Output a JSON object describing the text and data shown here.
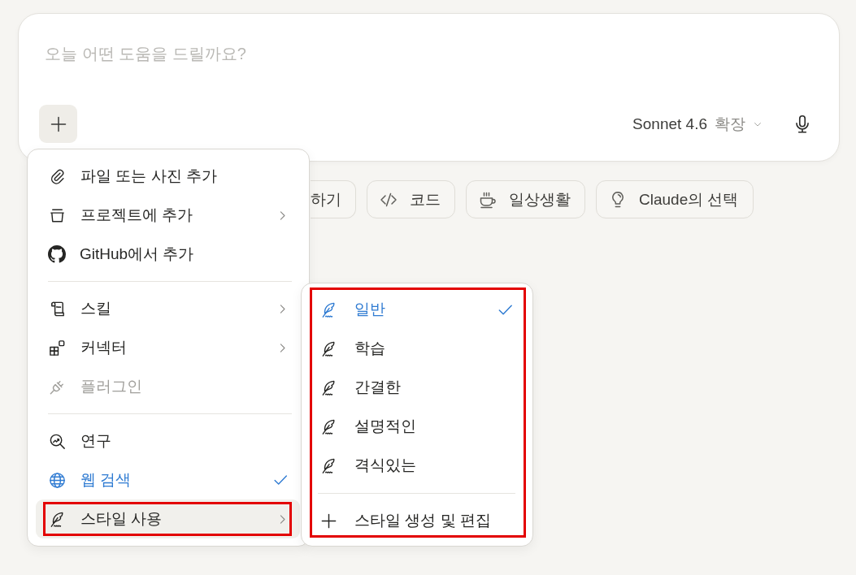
{
  "composer": {
    "placeholder": "오늘 어떤 도움을 드릴까요?",
    "model": "Sonnet 4.6",
    "mode": "확장"
  },
  "suggestions": [
    {
      "label": "하기",
      "kind": "cut"
    },
    {
      "label": "코드",
      "kind": "chip"
    },
    {
      "label": "일상생활",
      "kind": "chip"
    },
    {
      "label": "Claude의 선택",
      "kind": "chip"
    }
  ],
  "attach_menu": {
    "groups": [
      [
        {
          "label": "파일 또는 사진 추가",
          "submenu": false,
          "disabled": false,
          "checked": false,
          "open": false,
          "annotated": false
        },
        {
          "label": "프로젝트에 추가",
          "submenu": true,
          "disabled": false,
          "checked": false,
          "open": false,
          "annotated": false
        },
        {
          "label": "GitHub에서 추가",
          "submenu": false,
          "disabled": false,
          "checked": false,
          "open": false,
          "annotated": false
        }
      ],
      [
        {
          "label": "스킬",
          "submenu": true,
          "disabled": false,
          "checked": false,
          "open": false,
          "annotated": false
        },
        {
          "label": "커넥터",
          "submenu": true,
          "disabled": false,
          "checked": false,
          "open": false,
          "annotated": false
        },
        {
          "label": "플러그인",
          "submenu": false,
          "disabled": true,
          "checked": false,
          "open": false,
          "annotated": false
        }
      ],
      [
        {
          "label": "연구",
          "submenu": false,
          "disabled": false,
          "checked": false,
          "open": false,
          "annotated": false
        },
        {
          "label": "웹 검색",
          "submenu": false,
          "disabled": false,
          "checked": true,
          "open": false,
          "annotated": false
        },
        {
          "label": "스타일 사용",
          "submenu": true,
          "disabled": false,
          "checked": false,
          "open": true,
          "annotated": true
        }
      ]
    ]
  },
  "style_menu": {
    "annotated": true,
    "items": [
      {
        "label": "일반",
        "selected": true
      },
      {
        "label": "학습",
        "selected": false
      },
      {
        "label": "간결한",
        "selected": false
      },
      {
        "label": "설명적인",
        "selected": false
      },
      {
        "label": "격식있는",
        "selected": false
      }
    ],
    "action": "스타일 생성 및 편집"
  }
}
